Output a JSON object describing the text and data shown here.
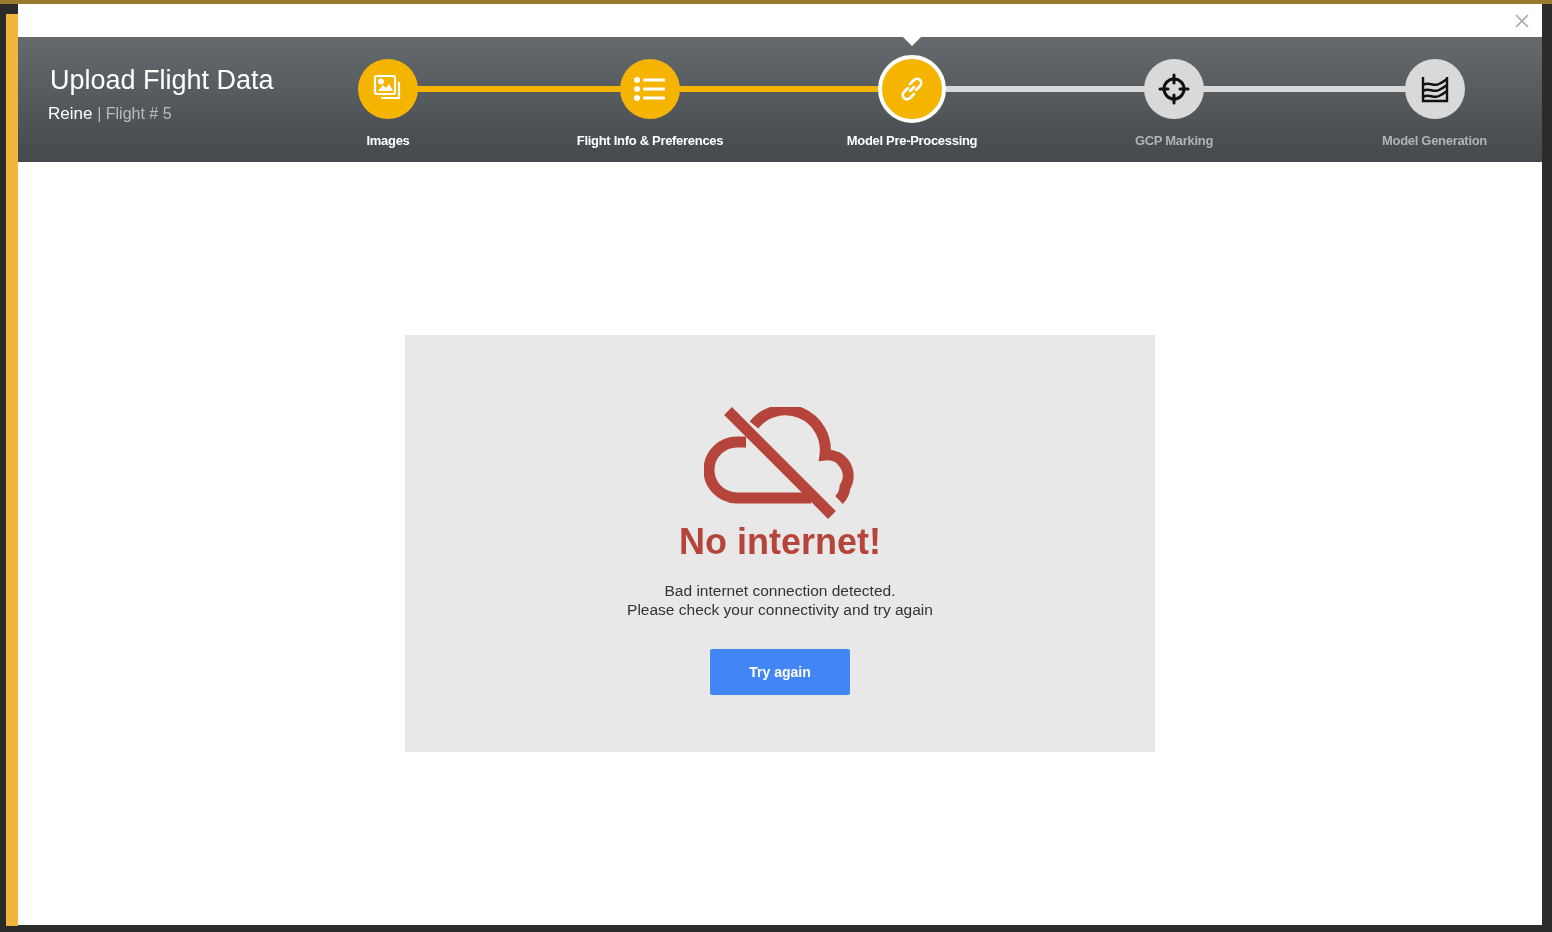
{
  "dialog": {
    "title": "Upload Flight Data",
    "project": "Reine",
    "flight": "| Flight # 5"
  },
  "steps": [
    {
      "label": "Images",
      "completed": true,
      "selected": false
    },
    {
      "label": "Flight Info & Preferences",
      "completed": true,
      "selected": false
    },
    {
      "label": "Model Pre-Processing",
      "completed": false,
      "selected": true
    },
    {
      "label": "GCP Marking",
      "completed": false,
      "selected": false
    },
    {
      "label": "Model Generation",
      "completed": false,
      "selected": false
    }
  ],
  "error": {
    "title": "No internet!",
    "lines": [
      "Bad internet connection detected.",
      "Please check your connectivity and try again"
    ],
    "button": "Try again"
  }
}
